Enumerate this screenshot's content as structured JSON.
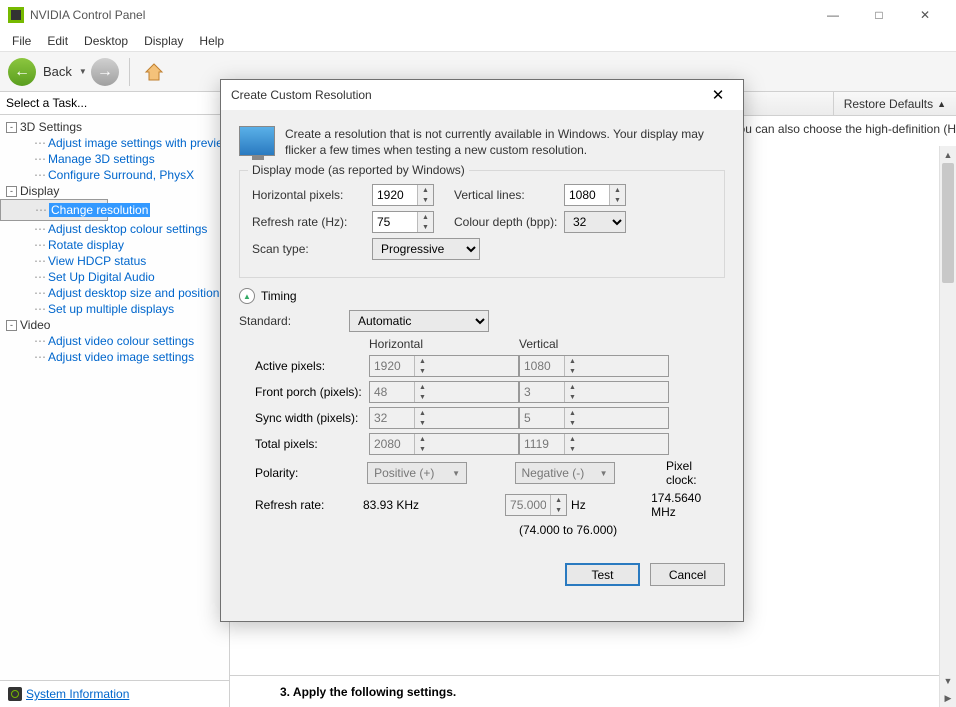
{
  "window": {
    "title": "NVIDIA Control Panel"
  },
  "menu": {
    "file": "File",
    "edit": "Edit",
    "desktop": "Desktop",
    "display": "Display",
    "help": "Help"
  },
  "toolbar": {
    "back": "Back"
  },
  "sidebar": {
    "header": "Select a Task...",
    "s1": "3D Settings",
    "s1a": "Adjust image settings with preview",
    "s1b": "Manage 3D settings",
    "s1c": "Configure Surround, PhysX",
    "s2": "Display",
    "s2a": "Change resolution",
    "s2b": "Adjust desktop colour settings",
    "s2c": "Rotate display",
    "s2d": "View HDCP status",
    "s2e": "Set Up Digital Audio",
    "s2f": "Adjust desktop size and position",
    "s2g": "Set up multiple displays",
    "s3": "Video",
    "s3a": "Adjust video colour settings",
    "s3b": "Adjust video image settings",
    "sysinfo": "System Information"
  },
  "main": {
    "restore": "Restore Defaults",
    "desc": "'ou can also choose the high-definition (H",
    "footer": "3. Apply the following settings."
  },
  "dialog": {
    "title": "Create Custom Resolution",
    "intro": "Create a resolution that is not currently available in Windows. Your display may flicker a few times when testing a new custom resolution.",
    "group1": "Display mode (as reported by Windows)",
    "hpx_lbl": "Horizontal pixels:",
    "hpx": "1920",
    "vln_lbl": "Vertical lines:",
    "vln": "1080",
    "rr_lbl": "Refresh rate (Hz):",
    "rr": "75",
    "cd_lbl": "Colour depth (bpp):",
    "cd": "32",
    "st_lbl": "Scan type:",
    "st": "Progressive",
    "timing": "Timing",
    "std_lbl": "Standard:",
    "std": "Automatic",
    "col_h": "Horizontal",
    "col_v": "Vertical",
    "ap_lbl": "Active pixels:",
    "ap_h": "1920",
    "ap_v": "1080",
    "fp_lbl": "Front porch (pixels):",
    "fp_h": "48",
    "fp_v": "3",
    "sw_lbl": "Sync width (pixels):",
    "sw_h": "32",
    "sw_v": "5",
    "tp_lbl": "Total pixels:",
    "tp_h": "2080",
    "tp_v": "1119",
    "pol_lbl": "Polarity:",
    "pol_h": "Positive (+)",
    "pol_v": "Negative (-)",
    "rr2_lbl": "Refresh rate:",
    "rr2_h": "83.93 KHz",
    "rr2_v": "75.000",
    "rr2_u": "Hz",
    "rr2_range": "(74.000 to 76.000)",
    "pc_lbl": "Pixel clock:",
    "pc": "174.5640 MHz",
    "test": "Test",
    "cancel": "Cancel"
  }
}
